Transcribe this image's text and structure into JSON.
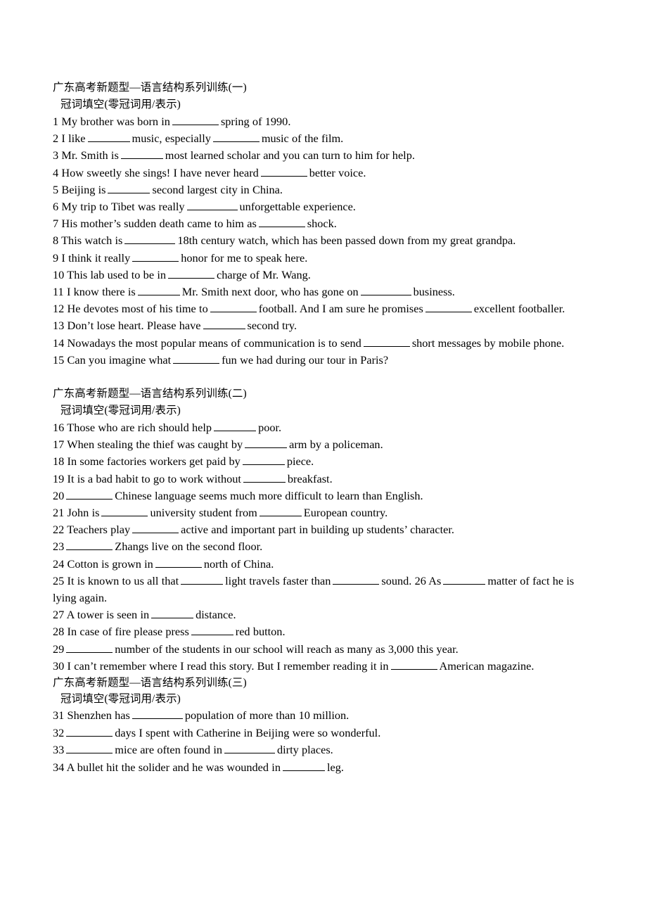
{
  "document": {
    "sections": [
      {
        "heading": "广东高考新题型—语言结构系列训练(一)",
        "subheading": "冠词填空(零冠词用/表示)",
        "items": [
          {
            "number": "1",
            "parts": [
              "1 My brother was born in",
              "spring of 1990."
            ],
            "blanks": [
              "w4"
            ]
          },
          {
            "number": "2",
            "parts": [
              "2 I like",
              "music, especially",
              "music of the film."
            ],
            "blanks": [
              "w3",
              "w4"
            ]
          },
          {
            "number": "3",
            "parts": [
              "3 Mr. Smith is",
              "most learned scholar and you can turn to him for help."
            ],
            "blanks": [
              "w3"
            ]
          },
          {
            "number": "4",
            "parts": [
              "4 How sweetly she sings! I have never heard",
              "better voice."
            ],
            "blanks": [
              "w4"
            ]
          },
          {
            "number": "5",
            "parts": [
              "5 Beijing is",
              "second largest city in China."
            ],
            "blanks": [
              "w3"
            ]
          },
          {
            "number": "6",
            "parts": [
              "6 My trip to Tibet was really",
              "unforgettable experience."
            ],
            "blanks": [
              "w5"
            ]
          },
          {
            "number": "7",
            "parts": [
              "7 His mother’s sudden death came to him as",
              "shock."
            ],
            "blanks": [
              "w4"
            ]
          },
          {
            "number": "8",
            "parts": [
              "8 This watch is",
              "18th century watch, which has been passed down from my great grandpa."
            ],
            "blanks": [
              "w5"
            ]
          },
          {
            "number": "9",
            "parts": [
              "9 I think it really",
              "honor for me to speak here."
            ],
            "blanks": [
              "w4"
            ]
          },
          {
            "number": "10",
            "parts": [
              "10 This lab used to be in",
              "charge of Mr. Wang."
            ],
            "blanks": [
              "w4"
            ]
          },
          {
            "number": "11",
            "parts": [
              "11 I know there is",
              "Mr. Smith next door, who has gone on",
              "business."
            ],
            "blanks": [
              "w3",
              "w5"
            ]
          },
          {
            "number": "12",
            "parts": [
              "12 He devotes most of his time to",
              "football. And I am sure he promises",
              "excellent footballer."
            ],
            "blanks": [
              "w4",
              "w4"
            ],
            "justify": true
          },
          {
            "number": "13",
            "parts": [
              "13 Don’t lose heart. Please have",
              "second try."
            ],
            "blanks": [
              "w3"
            ]
          },
          {
            "number": "14",
            "parts": [
              "14 Nowadays the most popular means of communication is to send",
              "short messages by mobile phone."
            ],
            "blanks": [
              "w4"
            ]
          },
          {
            "number": "15",
            "parts": [
              "15 Can you imagine what",
              "fun we had during our tour in Paris?"
            ],
            "blanks": [
              "w4"
            ]
          }
        ]
      },
      {
        "heading": "广东高考新题型—语言结构系列训练(二)",
        "subheading": "冠词填空(零冠词用/表示)",
        "gap_before": true,
        "items": [
          {
            "number": "16",
            "parts": [
              "16 Those who are rich should help",
              "poor."
            ],
            "blanks": [
              "w3"
            ]
          },
          {
            "number": "17",
            "parts": [
              "17 When stealing the thief was caught by",
              "arm by a policeman."
            ],
            "blanks": [
              "w3"
            ]
          },
          {
            "number": "18",
            "parts": [
              "18 In some factories workers get paid by",
              "piece."
            ],
            "blanks": [
              "w3"
            ]
          },
          {
            "number": "19",
            "parts": [
              "19 It is a bad habit to go to work without",
              "breakfast."
            ],
            "blanks": [
              "w3"
            ]
          },
          {
            "number": "20",
            "parts": [
              "20",
              "Chinese language seems much more difficult to learn than English."
            ],
            "blanks": [
              "w4"
            ]
          },
          {
            "number": "21",
            "parts": [
              "21 John is",
              "university student from",
              "European country."
            ],
            "blanks": [
              "w4",
              "w3"
            ]
          },
          {
            "number": "22",
            "parts": [
              "22 Teachers play",
              "active and important part in building up students’ character."
            ],
            "blanks": [
              "w4"
            ]
          },
          {
            "number": "23",
            "parts": [
              "23",
              "Zhangs live on the second floor."
            ],
            "blanks": [
              "w4"
            ]
          },
          {
            "number": "24",
            "parts": [
              "24 Cotton is grown in",
              "north of China."
            ],
            "blanks": [
              "w4"
            ]
          },
          {
            "number": "25",
            "parts": [
              "25 It is known to us all that",
              "light travels faster than",
              "sound. 26 As",
              "matter of fact he is lying again."
            ],
            "blanks": [
              "w3",
              "w4",
              "w3"
            ]
          },
          {
            "number": "27",
            "parts": [
              "27 A tower is seen in",
              "distance."
            ],
            "blanks": [
              "w3"
            ]
          },
          {
            "number": "28",
            "parts": [
              "28 In case of fire please press",
              "red button."
            ],
            "blanks": [
              "w3"
            ]
          },
          {
            "number": "29",
            "parts": [
              "29",
              "number of the students in our school will reach as many as 3,000 this year."
            ],
            "blanks": [
              "w4"
            ]
          },
          {
            "number": "30",
            "parts": [
              "30 I can’t remember where I read this story. But I remember reading it in",
              "American magazine."
            ],
            "blanks": [
              "w4"
            ],
            "justify": true
          }
        ]
      },
      {
        "heading": "广东高考新题型—语言结构系列训练(三)",
        "subheading": "冠词填空(零冠词用/表示)",
        "items": [
          {
            "number": "31",
            "parts": [
              "31 Shenzhen has",
              "population of more than 10 million."
            ],
            "blanks": [
              "w5"
            ]
          },
          {
            "number": "32",
            "parts": [
              "32",
              "days I spent with Catherine in Beijing were so wonderful."
            ],
            "blanks": [
              "w4"
            ]
          },
          {
            "number": "33",
            "parts": [
              "33",
              "mice are often found in",
              "dirty places."
            ],
            "blanks": [
              "w4",
              "w5"
            ]
          },
          {
            "number": "34",
            "parts": [
              "34 A bullet hit the solider and he was wounded in",
              "leg."
            ],
            "blanks": [
              "w3"
            ]
          }
        ]
      }
    ]
  }
}
